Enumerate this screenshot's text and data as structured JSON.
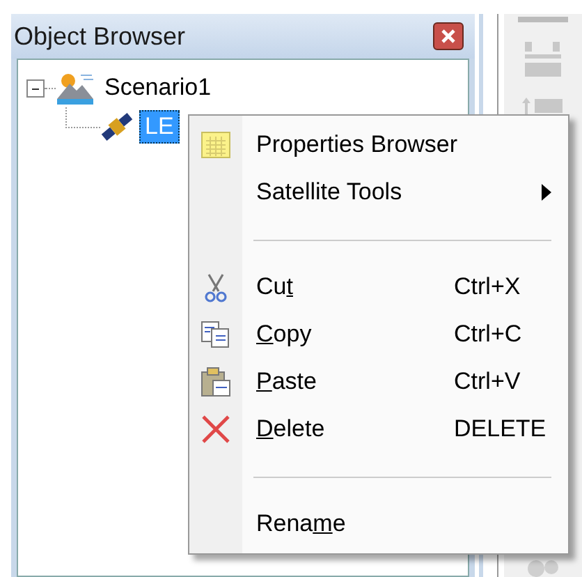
{
  "panel": {
    "title": "Object Browser"
  },
  "tree": [
    {
      "label": "Scenario1",
      "kind": "scenario",
      "expanded": true,
      "selected": false,
      "children": [
        {
          "label": "LE",
          "kind": "satellite",
          "selected": true
        }
      ]
    }
  ],
  "context_menu": [
    {
      "kind": "item",
      "pre": "Properties Browser",
      "submenu": false
    },
    {
      "kind": "item",
      "pre": "Satellite Tools",
      "submenu": true
    },
    {
      "kind": "separator"
    },
    {
      "kind": "item",
      "pre": "Cu",
      "key": "t",
      "shortcut": "Ctrl+X",
      "submenu": false
    },
    {
      "kind": "item",
      "key": "C",
      "post": "opy",
      "shortcut": "Ctrl+C",
      "submenu": false
    },
    {
      "kind": "item",
      "key": "P",
      "post": "aste",
      "shortcut": "Ctrl+V",
      "submenu": false
    },
    {
      "kind": "item",
      "key": "D",
      "post": "elete",
      "shortcut": "DELETE",
      "submenu": false
    },
    {
      "kind": "separator"
    },
    {
      "kind": "item",
      "pre": "Rena",
      "key": "m",
      "post": "e",
      "submenu": false
    }
  ]
}
